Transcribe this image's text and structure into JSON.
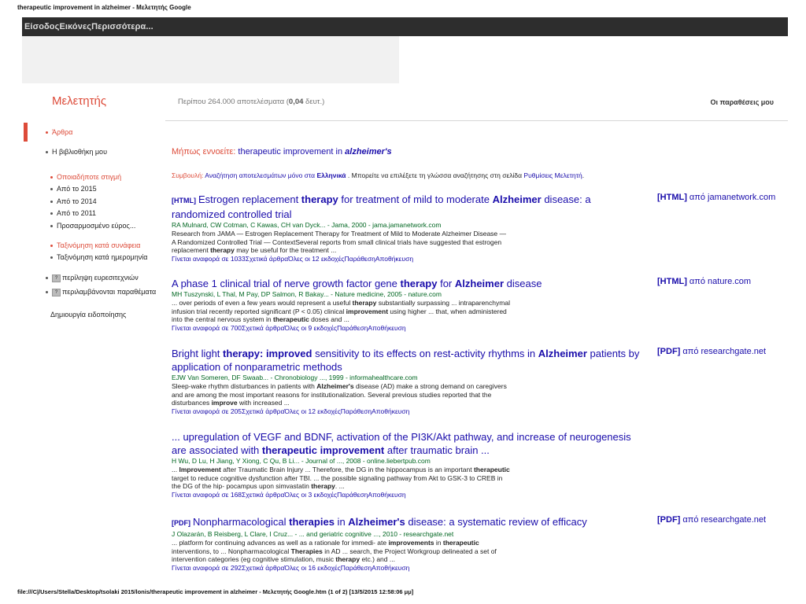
{
  "print_header": "therapeutic improvement in alzheimer - Μελετητής Google",
  "print_footer": "file:///C|/Users/Stella/Desktop/tsolaki 2015/lonis/therapeutic improvement in alzheimer - Μελετητής Google.htm (1 of 2) [13/5/2015 12:58:06 μμ]",
  "topbar": {
    "links": "ΕίσοδοςΕικόνεςΠερισσότερα..."
  },
  "brand": "Μελετητής",
  "stats": {
    "prefix": "Περίπου 264.000 αποτελέσματα (",
    "time": "0,04",
    "suffix": " δευτ.)"
  },
  "my_citations": "Οι παραθέσεις μου",
  "sidebar": {
    "articles": "Άρθρα",
    "library": "Η βιβλιοθήκη μου",
    "time_filters": [
      "Οποιαδήποτε στιγμή",
      "Από το 2015",
      "Από το 2014",
      "Από το 2011",
      "Προσαρμοσμένο εύρος..."
    ],
    "sort_relevance": "Ταξινόμηση κατά συνάφεια",
    "sort_date": "Ταξινόμηση κατά ημερομηνία",
    "include_patents": "περίληψη ευρεσιτεχνιών",
    "include_citations": "περιλαμβάνονται παραθέματα",
    "create_alert": "Δημιουργία ειδοποίησης"
  },
  "suggestion": {
    "label": "Μήπως εννοείτε:",
    "query_plain": " therapeutic improvement in ",
    "query_italic": "alzheimer's"
  },
  "lang_note": {
    "label": "Συμβουλή:",
    "text_a": " Αναζήτηση αποτελεσμάτων μόνο στα ",
    "lang": "Ελληνικά",
    "text_b": " . Μπορείτε να επιλέξετε τη γλώσσα αναζήτησης στη σελίδα ",
    "link": "Ρυθμίσεις Μελετητή",
    "end": "."
  },
  "results": [
    {
      "tag": "[HTML]",
      "title_parts": [
        {
          "t": "Estrogen replacement ",
          "b": false
        },
        {
          "t": "therapy",
          "b": true
        },
        {
          "t": " for treatment of mild to moderate ",
          "b": false
        },
        {
          "t": "Alzheimer",
          "b": true
        },
        {
          "t": " disease: a randomized controlled trial",
          "b": false
        }
      ],
      "authors": "RA Mulnard, CW Cotman, C Kawas, CH van Dyck... - Jama, 2000 - jama.jamanetwork.com",
      "snippet": "Research from JAMA — Estrogen Replacement Therapy for Treatment of Mild to Moderate Alzheimer Disease — A Randomized Controlled Trial — ContextSeveral reports from small clinical trials have suggested that estrogen replacement therapy may be useful for the treatment ...",
      "actions": "Γίνεται αναφορά σε 1033Σχετικά άρθραΌλες οι 12 εκδοχέςΠαράθεσηΑποθήκευση",
      "side_tag": "[HTML]",
      "side_text": " από jamanetwork.com"
    },
    {
      "tag": "",
      "title_parts": [
        {
          "t": "A phase 1 clinical trial of nerve growth factor gene ",
          "b": false
        },
        {
          "t": "therapy",
          "b": true
        },
        {
          "t": " for ",
          "b": false
        },
        {
          "t": "Alzheimer",
          "b": true
        },
        {
          "t": " disease",
          "b": false
        }
      ],
      "authors": "MH Tuszynski, L Thal, M Pay, DP Salmon, R Bakay... - Nature medicine, 2005 - nature.com",
      "snippet": "... over periods of even a few years would represent a useful therapy substantially surpassing ... intraparenchymal infusion trial recently reported significant (P < 0.05) clinical improvement using higher ... that, when administered into the central nervous system in therapeutic doses and ...",
      "actions": "Γίνεται αναφορά σε 700Σχετικά άρθραΌλες οι 9 εκδοχέςΠαράθεσηΑποθήκευση",
      "side_tag": "[HTML]",
      "side_text": " από nature.com"
    },
    {
      "tag": "",
      "title_parts": [
        {
          "t": "Bright light ",
          "b": false
        },
        {
          "t": "therapy: improved",
          "b": true
        },
        {
          "t": " sensitivity to its effects on rest-activity rhythms in ",
          "b": false
        },
        {
          "t": "Alzheimer",
          "b": true
        },
        {
          "t": " patients by application of nonparametric methods",
          "b": false
        }
      ],
      "authors": "EJW Van Someren, DF Swaab... - Chronobiology ..., 1999 - informahealthcare.com",
      "snippet": "Sleep-wake rhythm disturbances in patients with Alzheimer's disease (AD) make a strong demand on caregivers and are among the most important reasons for institutionalization. Several previous studies reported that the disturbances improve with increased ...",
      "actions": "Γίνεται αναφορά σε 205Σχετικά άρθραΌλες οι 12 εκδοχέςΠαράθεσηΑποθήκευση",
      "side_tag": "[PDF]",
      "side_text": " από researchgate.net"
    },
    {
      "tag": "",
      "title_parts": [
        {
          "t": "... upregulation of VEGF and BDNF, activation of the PI3K/Akt pathway, and increase of neurogenesis are associated with ",
          "b": false
        },
        {
          "t": "therapeutic improvement",
          "b": true
        },
        {
          "t": " after traumatic brain ...",
          "b": false
        }
      ],
      "authors": "H Wu, D Lu, H Jiang, Y Xiong, C Qu, B Li... - Journal of ..., 2008 - online.liebertpub.com",
      "snippet": "... Improvement after Traumatic Brain Injury ... Therefore, the DG in the hippocampus is an important therapeutic target to reduce cognitive dysfunction after TBI. ... the possible signaling pathway from Akt to GSK-3 to CREB in the DG of the hip- pocampus upon simvastatin therapy. ...",
      "actions": "Γίνεται αναφορά σε 168Σχετικά άρθραΌλες οι 3 εκδοχέςΠαράθεσηΑποθήκευση",
      "side_tag": "",
      "side_text": ""
    },
    {
      "tag": "[PDF]",
      "title_parts": [
        {
          "t": "Nonpharmacological ",
          "b": false
        },
        {
          "t": "therapies",
          "b": true
        },
        {
          "t": " in ",
          "b": false
        },
        {
          "t": "Alzheimer's",
          "b": true
        },
        {
          "t": " disease: a systematic review of efficacy",
          "b": false
        }
      ],
      "authors": "J Olazarán, B Reisberg, L Clare, I Cruz... - ... and geriatric cognitive ..., 2010 - researchgate.net",
      "snippet": "... platform for continuing advances as well as a rationale for immedi- ate improvements in therapeutic interventions, to ... Nonpharmacological Therapies in AD ... search, the Project Workgroup delineated a set of intervention categories (eg cognitive stimulation, music therapy etc.) and ...",
      "actions": "Γίνεται αναφορά σε 292Σχετικά άρθραΌλες οι 16 εκδοχέςΠαράθεσηΑποθήκευση",
      "side_tag": "[PDF]",
      "side_text": " από researchgate.net"
    }
  ]
}
